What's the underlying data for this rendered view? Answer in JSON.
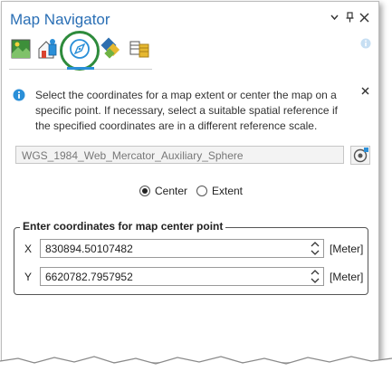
{
  "pane": {
    "title": "Map Navigator",
    "header_buttons": [
      "options-chevron",
      "pin",
      "close"
    ]
  },
  "toolbar": {
    "tabs": [
      {
        "icon": "map-image-icon"
      },
      {
        "icon": "bookmarks-icon"
      },
      {
        "icon": "locate-compass-icon",
        "active": true
      },
      {
        "icon": "layers-icon"
      },
      {
        "icon": "table-icon"
      }
    ]
  },
  "message": {
    "text": "Select the coordinates for a map extent or center the map on a specific point. If necessary, select a suitable spatial reference if the specified coordinates are in a different reference scale."
  },
  "spatial_reference": {
    "value": "WGS_1984_Web_Mercator_Auxiliary_Sphere"
  },
  "mode": {
    "options": [
      "Center",
      "Extent"
    ],
    "selected": "Center"
  },
  "coordinates": {
    "group_label": "Enter coordinates for map center point",
    "x_label": "X",
    "x_value": "830894.50107482",
    "y_label": "Y",
    "y_value": "6620782.7957952",
    "unit": "[Meter]"
  },
  "colors": {
    "title": "#2a6fb5",
    "accent": "#2a8fd8",
    "highlight_ring": "#2e8b3c",
    "info": "#2a8fd8"
  }
}
